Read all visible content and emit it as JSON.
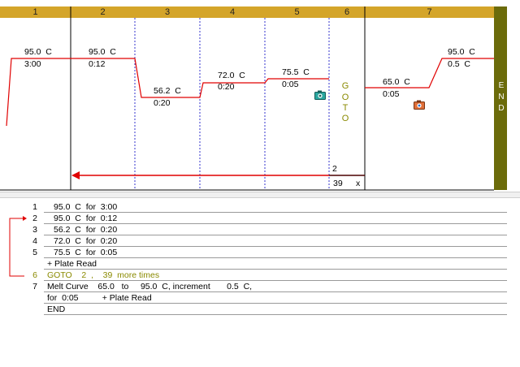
{
  "header": {
    "steps": [
      "1",
      "2",
      "3",
      "4",
      "5",
      "6",
      "7"
    ],
    "header_color": "#d4a52a"
  },
  "graph": {
    "step1": {
      "temp": "95.0  C",
      "time": "3:00"
    },
    "step2": {
      "temp": "95.0  C",
      "time": "0:12"
    },
    "step3": {
      "temp": "56.2  C",
      "time": "0:20"
    },
    "step4": {
      "temp": "72.0  C",
      "time": "0:20"
    },
    "step5": {
      "temp": "75.5  C",
      "time": "0:05"
    },
    "goto_letters": [
      "G",
      "O",
      "T",
      "O"
    ],
    "goto_target": "2",
    "goto_count": "39",
    "goto_x": "x",
    "step7": {
      "temp": "65.0  C",
      "time": "0:05",
      "end_temp": "95.0  C",
      "increment": "0.5  C"
    },
    "end_letters": [
      "E",
      "N",
      "D"
    ],
    "line_color": "#e00000",
    "end_bar_color": "#6b6b0a"
  },
  "protocol": {
    "lines": [
      {
        "num": "1",
        "text": "95.0  C  for  3:00"
      },
      {
        "num": "2",
        "text": "95.0  C  for  0:12"
      },
      {
        "num": "3",
        "text": "56.2  C  for  0:20"
      },
      {
        "num": "4",
        "text": "72.0  C  for  0:20"
      },
      {
        "num": "5",
        "text": "75.5  C  for  0:05"
      },
      {
        "num": "",
        "text": "+ Plate Read"
      },
      {
        "num": "6",
        "text": "GOTO    2  ,    39  more times"
      },
      {
        "num": "7",
        "text": "Melt Curve    65.0   to     95.0  C, increment       0.5  C,"
      },
      {
        "num": "",
        "text": "for  0:05          + Plate Read"
      },
      {
        "num": "",
        "text": "END"
      }
    ]
  }
}
